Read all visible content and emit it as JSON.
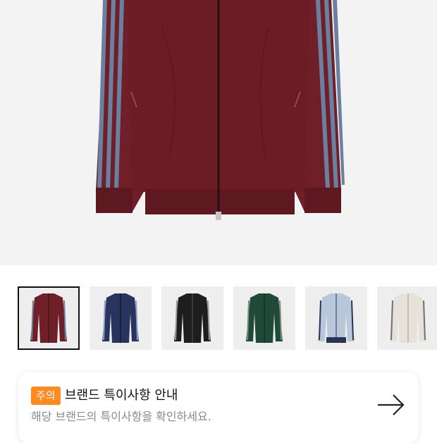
{
  "product": {
    "image_icon": "burgundy-track-jacket",
    "main_color": "#6e1f27"
  },
  "thumbnails": [
    {
      "color_name": "burgundy",
      "body": "#6e1f27",
      "stripe": "#6b7fa0",
      "selected": true
    },
    {
      "color_name": "navy",
      "body": "#28345e",
      "stripe": "#8ea0c2",
      "selected": false
    },
    {
      "color_name": "black",
      "body": "#1e1e1e",
      "stripe": "#9a9a9a",
      "selected": false
    },
    {
      "color_name": "green",
      "body": "#1f4a38",
      "stripe": "#7d8c7e",
      "selected": false
    },
    {
      "color_name": "light-blue",
      "body": "#b9c7da",
      "stripe": "#2a3450",
      "selected": false
    },
    {
      "color_name": "cream",
      "body": "#e6e2da",
      "stripe": "#6f6f6f",
      "selected": false
    }
  ],
  "notice": {
    "badge": "주의",
    "title": "브랜드 특이사항 안내",
    "description": "해당 브랜드의 특이사항을 확인하세요.",
    "arrow_icon": "arrow-right-icon",
    "badge_color": "#ff8a1f"
  }
}
